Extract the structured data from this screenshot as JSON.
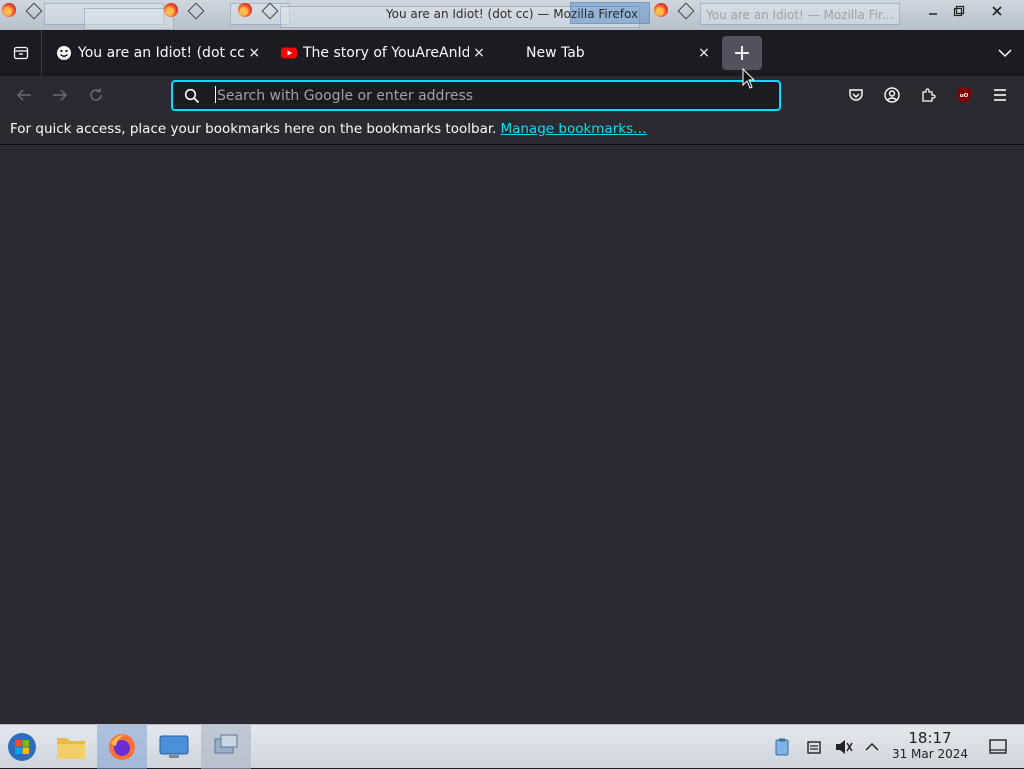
{
  "window": {
    "title": "You are an Idiot! (dot cc) — Mozilla Firefox",
    "ghost_title": "You are an Idiot! — Mozilla Fir..."
  },
  "tabs": [
    {
      "label": "You are an Idiot! (dot cc)",
      "favicon": "smiley-icon",
      "close": "×"
    },
    {
      "label": "The story of YouAreAnIdi",
      "favicon": "youtube-icon",
      "close": "×"
    },
    {
      "label": "New Tab",
      "favicon": "",
      "close": "×"
    }
  ],
  "new_tab_symbol": "+",
  "urlbar": {
    "placeholder": "Search with Google or enter address",
    "value": ""
  },
  "bookmarks_bar": {
    "message": "For quick access, place your bookmarks here on the bookmarks toolbar.",
    "link": "Manage bookmarks…"
  },
  "taskbar": {
    "time": "18:17",
    "date": "31 Mar 2024"
  },
  "colors": {
    "accent": "#00ddff",
    "chrome_dark": "#1c1b22",
    "toolbar": "#2b2a33"
  }
}
